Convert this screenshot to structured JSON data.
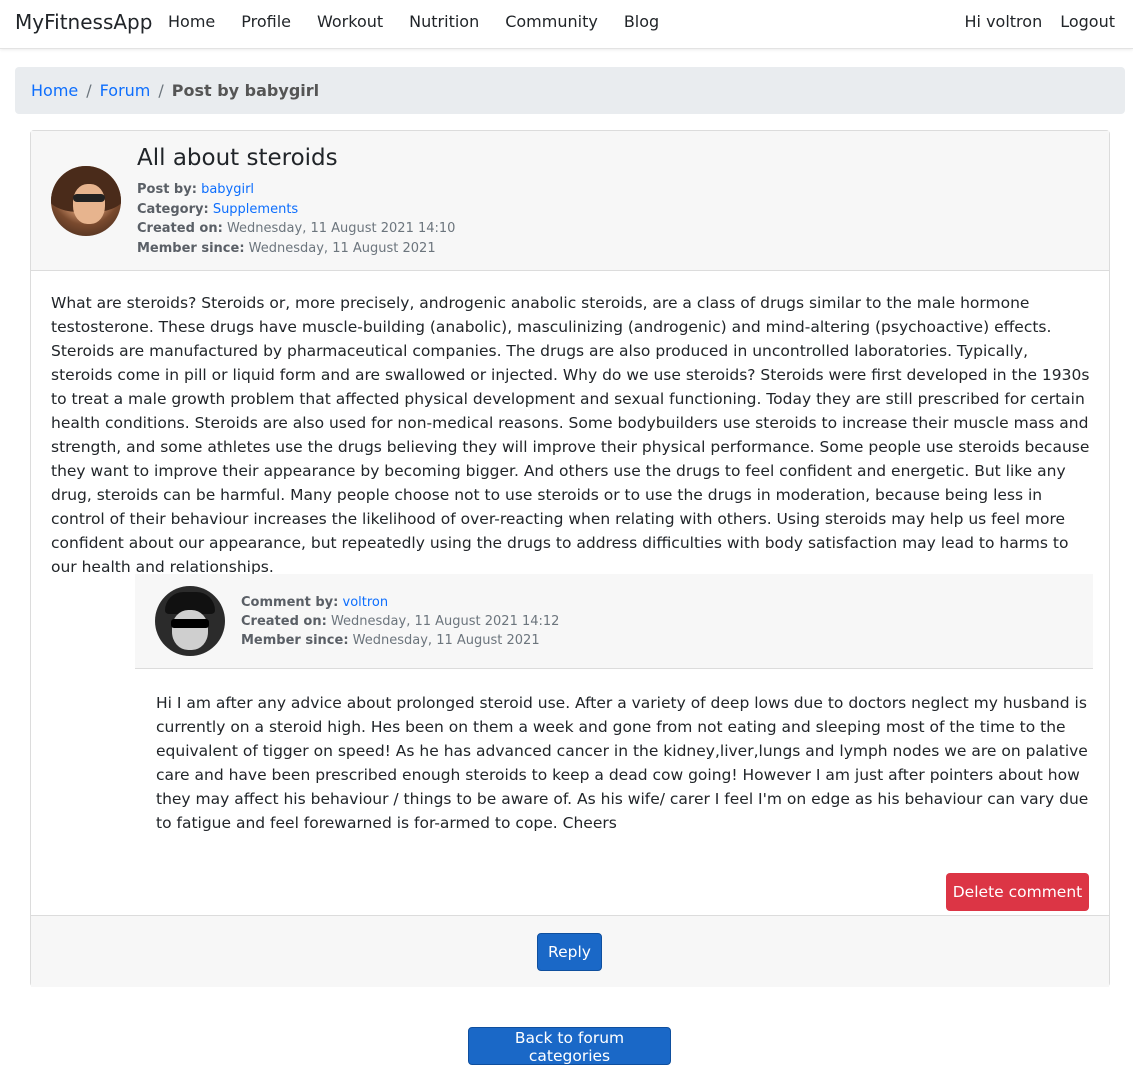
{
  "navbar": {
    "brand": "MyFitnessApp",
    "links": [
      "Home",
      "Profile",
      "Workout",
      "Nutrition",
      "Community",
      "Blog"
    ],
    "greeting": "Hi voltron",
    "logout": "Logout"
  },
  "breadcrumb": {
    "home": "Home",
    "forum": "Forum",
    "current": "Post by babygirl",
    "separator": "/"
  },
  "post": {
    "title": "All about steroids",
    "post_by_label": "Post by:",
    "author": "babygirl",
    "category_label": "Category:",
    "category": "Supplements",
    "created_label": "Created on:",
    "created": "Wednesday, 11 August 2021 14:10",
    "member_label": "Member since:",
    "member_since": "Wednesday, 11 August 2021",
    "body": "What are steroids?  Steroids or, more precisely, androgenic anabolic steroids, are a class of drugs similar to the male hormone testosterone. These drugs have muscle-building (anabolic), masculinizing (androgenic) and mind-altering (psychoactive) effects.  Steroids are manufactured by pharmaceutical companies. The drugs are also produced in uncontrolled laboratories. Typically, steroids come in pill or liquid form and are swallowed or injected.  Why do we use steroids?  Steroids were first developed in the 1930s to treat a male growth problem that affected physical development and sexual functioning. Today they are still prescribed for certain health conditions. Steroids are also used for non-medical reasons. Some bodybuilders use steroids to increase their muscle mass and strength, and some athletes use the drugs believing they will improve their physical performance. Some people use steroids because they want to improve their appearance by becoming bigger. And others use the drugs to feel confident and energetic. But like any drug, steroids can be harmful.  Many people choose not to use steroids or to use the drugs in moderation, because being less in control of their behaviour increases the likelihood of over-reacting when relating with others. Using steroids may help us feel more confident about our appearance, but repeatedly using the drugs to address difficulties with body satisfaction may lead to harms to our health and relationships."
  },
  "comment": {
    "by_label": "Comment by:",
    "author": "voltron",
    "created_label": "Created on:",
    "created": "Wednesday, 11 August 2021 14:12",
    "member_label": "Member since:",
    "member_since": "Wednesday, 11 August 2021",
    "body": "Hi  I am after any advice about prolonged steroid use.  After a variety of deep lows due to doctors neglect my husband is currently on a steroid high. Hes been on them a week and gone from not eating and sleeping most of the time to the equivalent of tigger on speed! As he has advanced cancer in the kidney,liver,lungs and lymph nodes we are on palative care and have been prescribed enough steroids to keep a dead cow going! However I am just after pointers about how they may affect his behaviour / things to be aware of. As his wife/ carer I feel I'm on edge as his behaviour can vary due to fatigue and feel forewarned is for-armed to cope.  Cheers",
    "delete_label": "Delete comment"
  },
  "actions": {
    "reply": "Reply",
    "back": "Back to forum categories"
  },
  "colors": {
    "link": "#0d6efd",
    "danger": "#dc3545",
    "primary": "#1a68c7"
  }
}
